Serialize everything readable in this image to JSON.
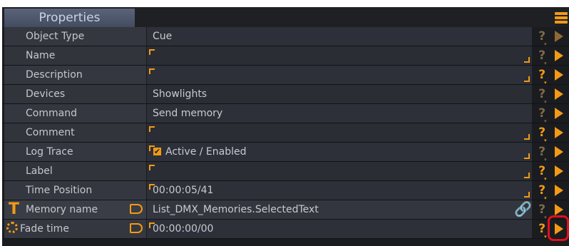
{
  "header": {
    "title": "Properties"
  },
  "rows": [
    {
      "label": "Object Type",
      "value": "Cue",
      "help_dim": true
    },
    {
      "label": "Name",
      "value": "",
      "help_dim": true
    },
    {
      "label": "Description",
      "value": "",
      "help_dim": false
    },
    {
      "label": "Devices",
      "value": "Showlights",
      "help_dim": true
    },
    {
      "label": "Command",
      "value": "Send memory",
      "help_dim": true
    },
    {
      "label": "Comment",
      "value": "",
      "help_dim": false
    },
    {
      "label": "Log Trace",
      "value": "Active / Enabled",
      "help_dim": true
    },
    {
      "label": "Label",
      "value": "",
      "help_dim": false
    },
    {
      "label": "Time Position",
      "value": "00:00:05/41",
      "help_dim": false
    },
    {
      "label": "Memory name",
      "value": "List_DMX_Memories.SelectedText",
      "help_dim": true
    },
    {
      "label": "Fade time",
      "value": "00:00:00/00",
      "help_dim": false
    }
  ],
  "icons": {
    "menu": "menu-icon",
    "help": "help-icon",
    "play": "play-icon",
    "checkbox": "checkbox-icon",
    "text_type": "text-type-icon",
    "clock": "clock-icon",
    "tag": "tag-icon",
    "link": "link-icon"
  },
  "colors": {
    "accent": "#f29a16",
    "highlight": "#e4101d",
    "panel_bg": "#1b1c20",
    "label_bg": "#34373f",
    "value_bg": "#2d3038",
    "tab_bg": "#4f576c"
  },
  "help_glyph": "?"
}
